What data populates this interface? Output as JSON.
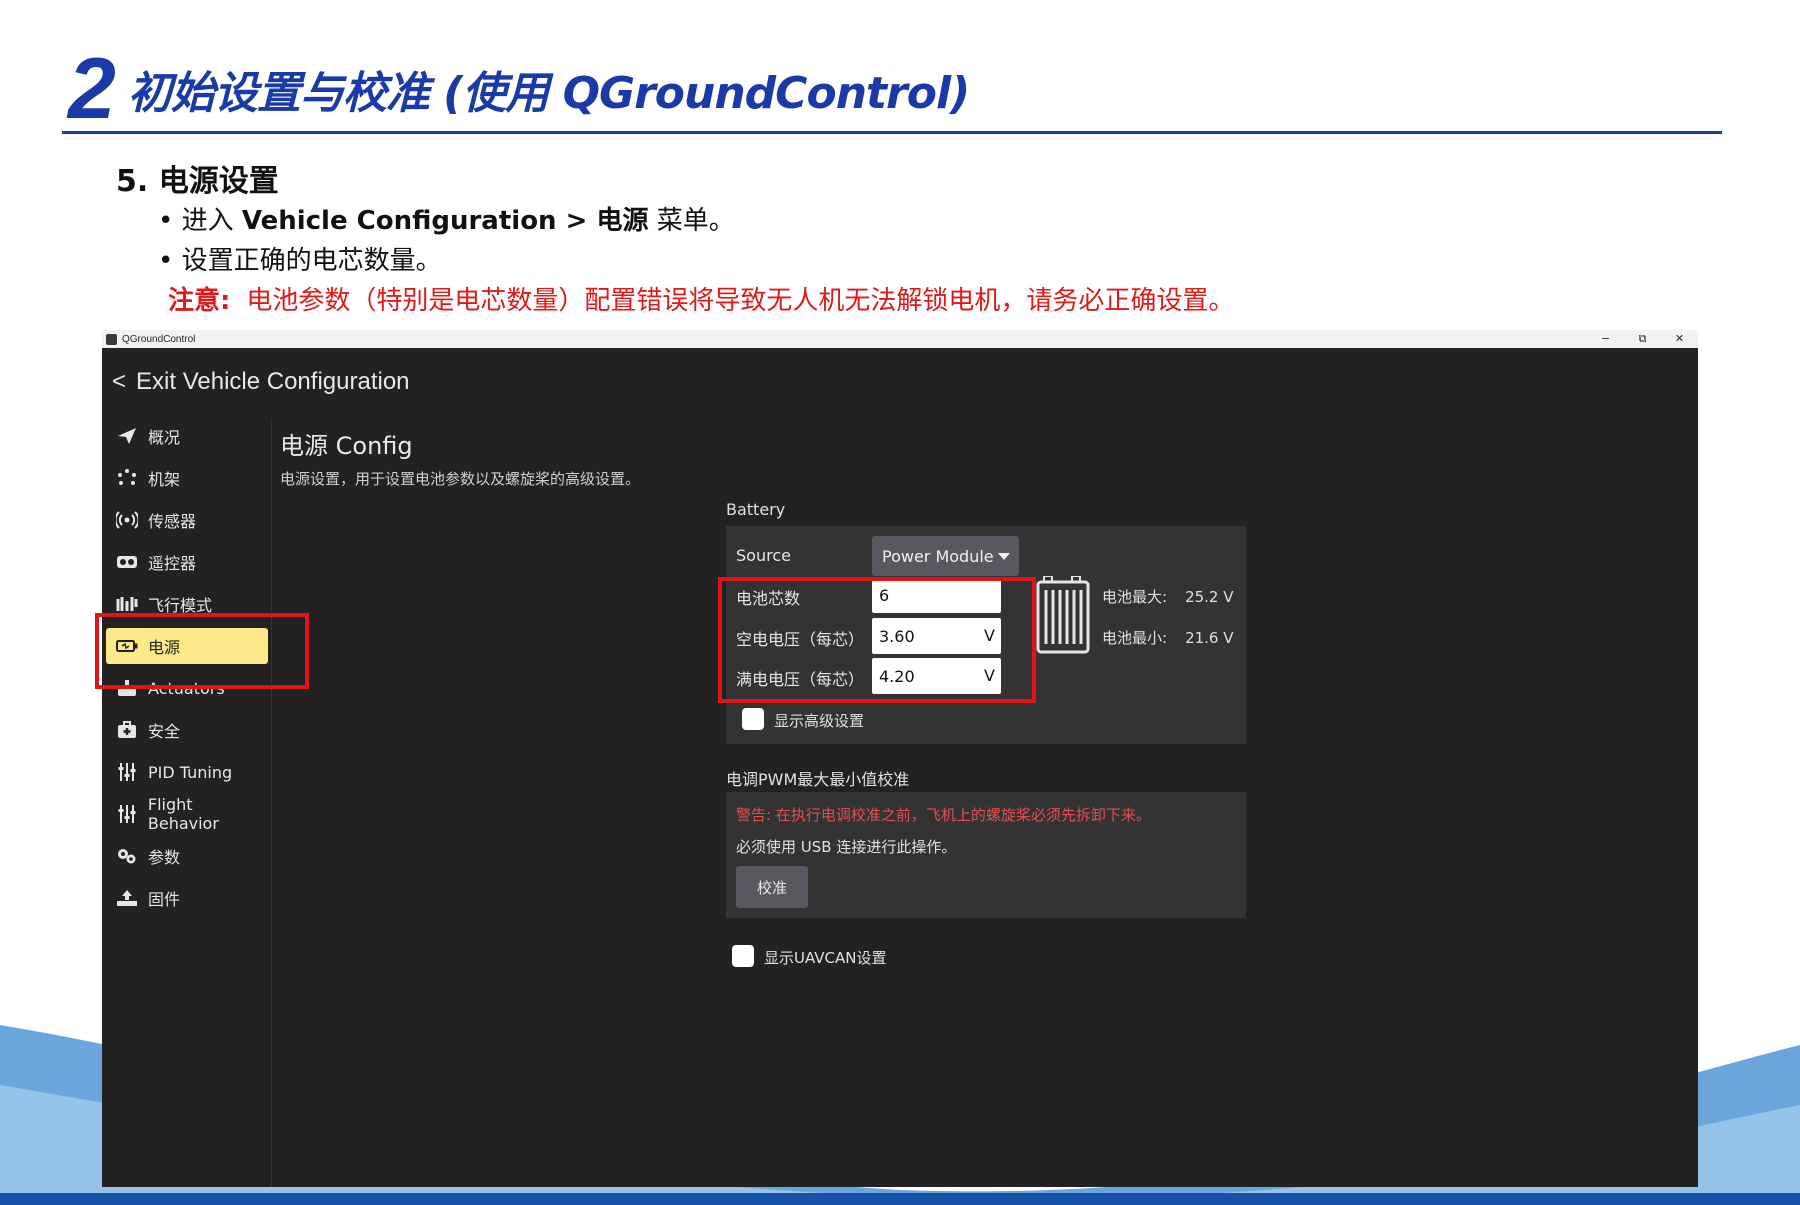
{
  "slide": {
    "section_number": "2",
    "section_title": "初始设置与校准 (使用 QGroundControl)",
    "heading": "5. 电源设置",
    "bullet1_prefix": "• 进入 ",
    "bullet1_bold": "Vehicle Configuration > 电源",
    "bullet1_suffix": " 菜单。",
    "bullet2": "• 设置正确的电芯数量。",
    "note_label": "注意:",
    "note_text": "电池参数（特别是电芯数量）配置错误将导致无人机无法解锁电机，请务必正确设置。",
    "colors": {
      "title_blue": "#1a3aa8",
      "note_red": "#e01a1a",
      "highlight_red": "#e11515"
    }
  },
  "window": {
    "app_title": "QGroundControl",
    "controls": [
      "−",
      "⧉",
      "✕"
    ],
    "exit_label": "Exit Vehicle Configuration",
    "exit_glyph": "<"
  },
  "sidebar": {
    "items": [
      {
        "label": "概况",
        "icon": "paper-plane-icon"
      },
      {
        "label": "机架",
        "icon": "frame-icon"
      },
      {
        "label": "传感器",
        "icon": "radio-waves-icon"
      },
      {
        "label": "遥控器",
        "icon": "gamepad-icon"
      },
      {
        "label": "飞行模式",
        "icon": "flight-modes-icon"
      },
      {
        "label": "电源",
        "icon": "battery-icon",
        "active": true
      },
      {
        "label": "Actuators",
        "icon": "actuator-icon"
      },
      {
        "label": "安全",
        "icon": "safety-kit-icon"
      },
      {
        "label": "PID Tuning",
        "icon": "sliders-icon"
      },
      {
        "label": "Flight Behavior",
        "icon": "sliders-icon"
      },
      {
        "label": "参数",
        "icon": "gears-icon"
      },
      {
        "label": "固件",
        "icon": "firmware-upload-icon"
      }
    ],
    "active_color": "#fde88a"
  },
  "main": {
    "title": "电源 Config",
    "description": "电源设置，用于设置电池参数以及螺旋桨的高级设置。",
    "battery": {
      "group_label": "Battery",
      "source_label": "Source",
      "source_value": "Power Module",
      "cells_label": "电池芯数",
      "cells_value": "6",
      "empty_label": "空电电压（每芯）",
      "empty_value": "3.60",
      "full_label": "满电电压（每芯）",
      "full_value": "4.20",
      "unit": "V",
      "max_label": "电池最大:",
      "max_value": "25.2 V",
      "min_label": "电池最小:",
      "min_value": "21.6 V",
      "advanced_label": "显示高级设置"
    },
    "esc": {
      "group_label": "电调PWM最大最小值校准",
      "warning": "警告: 在执行电调校准之前，飞机上的螺旋桨必须先拆卸下来。",
      "usb_note": "必须使用 USB 连接进行此操作。",
      "calibrate_label": "校准"
    },
    "uavcan_label": "显示UAVCAN设置"
  }
}
